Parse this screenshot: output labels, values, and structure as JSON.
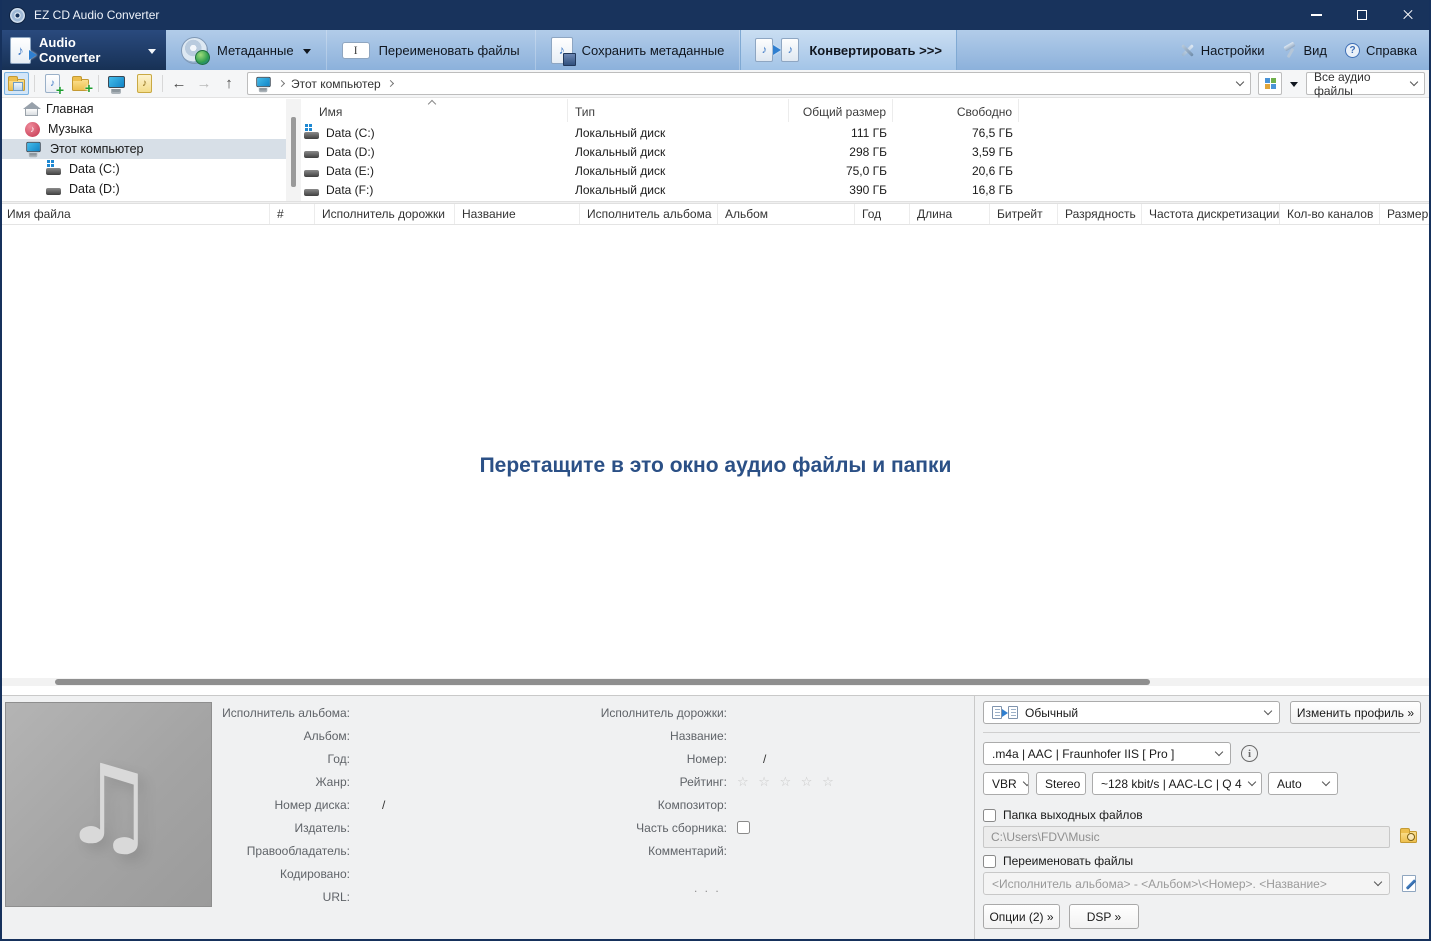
{
  "window": {
    "title": "EZ CD Audio Converter"
  },
  "ribbon": {
    "app_button": {
      "label": "Audio Converter"
    },
    "metadata_button": {
      "label": "Метаданные"
    },
    "rename_button": "Переименовать файлы",
    "save_metadata_button": "Сохранить метаданные",
    "convert_button": "Конвертировать >>>",
    "settings_button": "Настройки",
    "view_button": "Вид",
    "help_button": "Справка"
  },
  "navbar": {
    "back_glyph": "←",
    "forward_glyph": "→",
    "up_glyph": "↑",
    "breadcrumb_root": "Этот компьютер",
    "filter_dropdown": "Все аудио файлы"
  },
  "sidebar": {
    "items": [
      {
        "label": "Главная"
      },
      {
        "label": "Музыка"
      },
      {
        "label": "Этот компьютер"
      },
      {
        "label": "Data (C:)"
      },
      {
        "label": "Data (D:)"
      }
    ]
  },
  "drive_list": {
    "columns": {
      "name": "Имя",
      "type": "Тип",
      "size": "Общий размер",
      "free": "Свободно"
    },
    "rows": [
      {
        "name": "Data (C:)",
        "type": "Локальный диск",
        "size": "111 ГБ",
        "free": "76,5 ГБ"
      },
      {
        "name": "Data (D:)",
        "type": "Локальный диск",
        "size": "298 ГБ",
        "free": "3,59 ГБ"
      },
      {
        "name": "Data (E:)",
        "type": "Локальный диск",
        "size": "75,0 ГБ",
        "free": "20,6 ГБ"
      },
      {
        "name": "Data (F:)",
        "type": "Локальный диск",
        "size": "390 ГБ",
        "free": "16,8 ГБ"
      }
    ]
  },
  "track_list": {
    "columns": [
      "Имя файла",
      "#",
      "Исполнитель дорожки",
      "Название",
      "Исполнитель альбома",
      "Альбом",
      "Год",
      "Длина",
      "Битрейт",
      "Разрядность",
      "Частота дискретизации",
      "Кол-во каналов",
      "Размер"
    ],
    "drop_hint": "Перетащите в это окно аудио файлы и папки"
  },
  "metadata_panel": {
    "album_fields": {
      "album_artist_label": "Исполнитель альбома:",
      "album_label": "Альбом:",
      "year_label": "Год:",
      "genre_label": "Жанр:",
      "disc_number_label": "Номер диска:",
      "disc_number_value": "/",
      "publisher_label": "Издатель:",
      "copyright_label": "Правообладатель:",
      "encoded_label": "Кодировано:",
      "url_label": "URL:"
    },
    "track_fields": {
      "track_artist_label": "Исполнитель дорожки:",
      "title_label": "Название:",
      "number_label": "Номер:",
      "number_value": "/",
      "rating_label": "Рейтинг:",
      "rating_stars": "☆ ☆ ☆ ☆ ☆",
      "composer_label": "Композитор:",
      "compilation_label": "Часть сборника:",
      "comment_label": "Комментарий:"
    },
    "ellipsis": ". . ."
  },
  "settings_panel": {
    "profile_dropdown": "Обычный",
    "edit_profile_button": "Изменить профиль »",
    "format_dropdown": ".m4a  |  AAC  |  Fraunhofer IIS [ Pro ]",
    "mode_dropdown": "VBR",
    "channels_dropdown": "Stereo",
    "bitrate_dropdown": "~128 kbit/s | AAC-LC | Q 4",
    "quality_dropdown": "Auto",
    "output_folder_checkbox": "Папка выходных файлов",
    "output_folder_path": "C:\\Users\\FDV\\Music",
    "rename_checkbox": "Переименовать файлы",
    "rename_pattern": "<Исполнитель альбома> - <Альбом>\\<Номер>. <Название>",
    "options_button": "Опции (2) »",
    "dsp_button": "DSP »"
  }
}
